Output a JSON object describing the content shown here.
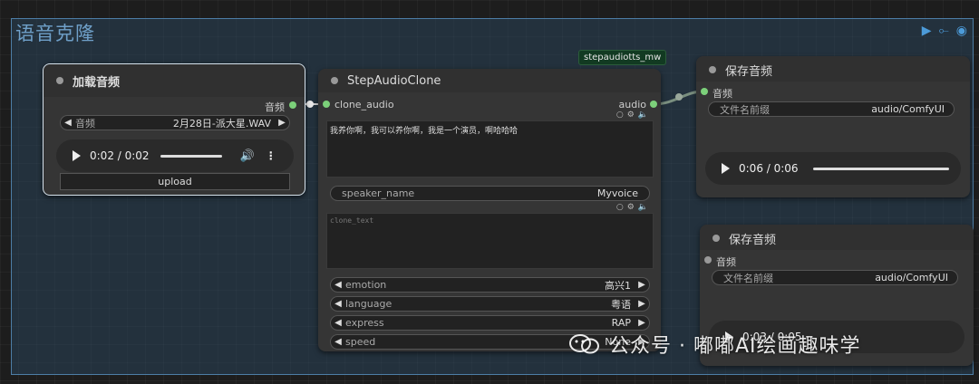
{
  "group": {
    "title": "语音克隆"
  },
  "badge": "stepaudiotts_mw",
  "load_node": {
    "title": "加载音频",
    "output_label": "音频",
    "file_label": "音频",
    "file_value": "2月28日-派大星.WAV",
    "player_time": "0:02 / 0:02",
    "upload_label": "upload"
  },
  "clone_node": {
    "title": "StepAudioClone",
    "input_label": "clone_audio",
    "output_label": "audio",
    "text": "我养你啊，我可以养你啊，我是一个演员，啊哈哈哈",
    "speaker_label": "speaker_name",
    "speaker_value": "Myvoice",
    "clone_text_placeholder": "clone_text",
    "emotion_label": "emotion",
    "emotion_value": "高兴1",
    "language_label": "language",
    "language_value": "粤语",
    "express_label": "express",
    "express_value": "RAP",
    "speed_label": "speed",
    "speed_value": "None"
  },
  "save_node_1": {
    "title": "保存音频",
    "input_label": "音频",
    "prefix_label": "文件名前缀",
    "prefix_value": "audio/ComfyUI",
    "player_time": "0:06 / 0:06"
  },
  "save_node_2": {
    "title": "保存音频",
    "input_label": "音频",
    "prefix_label": "文件名前缀",
    "prefix_value": "audio/ComfyUI",
    "player_time": "0:03 / 0:05"
  },
  "watermark": "公众号 · 嘟嘟AI绘画趣味学",
  "colors": {
    "link": "#7cd07a",
    "group_border": "#4d7ea6",
    "accent": "#4c9bd9"
  }
}
